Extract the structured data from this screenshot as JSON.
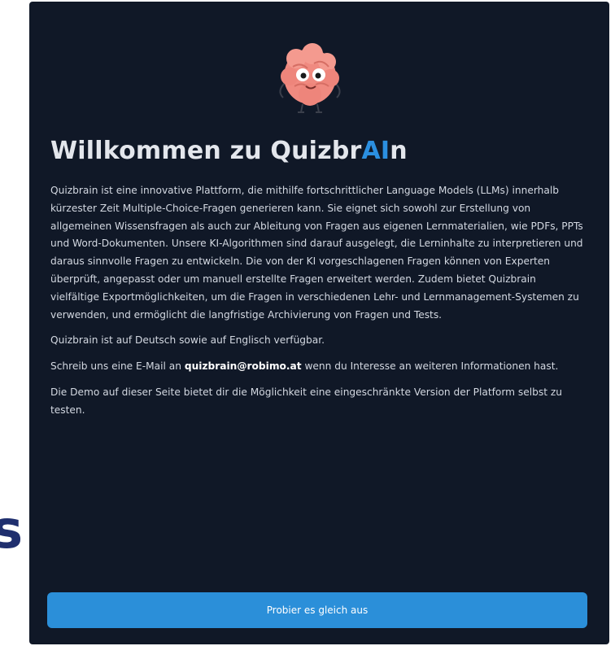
{
  "background": {
    "partial_heading_fragment": "s"
  },
  "modal": {
    "logo_icon": "brain-mascot-icon",
    "title_prefix": "Willkommen zu Quizbr",
    "title_ai": "AI",
    "title_suffix": "n",
    "paragraphs": {
      "intro": "Quizbrain ist eine innovative Plattform, die mithilfe fortschrittlicher Language Models (LLMs) innerhalb kürzester Zeit Multiple-Choice-Fragen generieren kann. Sie eignet sich sowohl zur Erstellung von allgemeinen Wissensfragen als auch zur Ableitung von Fragen aus eigenen Lernmaterialien, wie PDFs, PPTs und Word-Dokumenten. Unsere KI-Algorithmen sind darauf ausgelegt, die Lerninhalte zu interpretieren und daraus sinnvolle Fragen zu entwickeln. Die von der KI vorgeschlagenen Fragen können von Experten überprüft, angepasst oder um manuell erstellte Fragen erweitert werden. Zudem bietet Quizbrain vielfältige Exportmöglichkeiten, um die Fragen in verschiedenen Lehr- und Lernmanagement-Systemen zu verwenden, und ermöglicht die langfristige Archivierung von Fragen und Tests.",
      "languages": "Quizbrain ist auf Deutsch sowie auf Englisch verfügbar.",
      "contact_before": "Schreib uns eine E-Mail an ",
      "contact_email": "quizbrain@robimo.at",
      "contact_after": " wenn du Interesse an weiteren Informationen hast.",
      "demo": "Die Demo auf dieser Seite bietet dir die Möglichkeit eine eingeschränkte Version der Platform selbst zu testen."
    },
    "cta_label": "Probier es gleich aus"
  },
  "colors": {
    "modal_bg": "#101827",
    "accent": "#2b8fe0",
    "button_bg": "#2b8fd9",
    "text": "#d3d8e1",
    "brain": "#f08a80"
  }
}
